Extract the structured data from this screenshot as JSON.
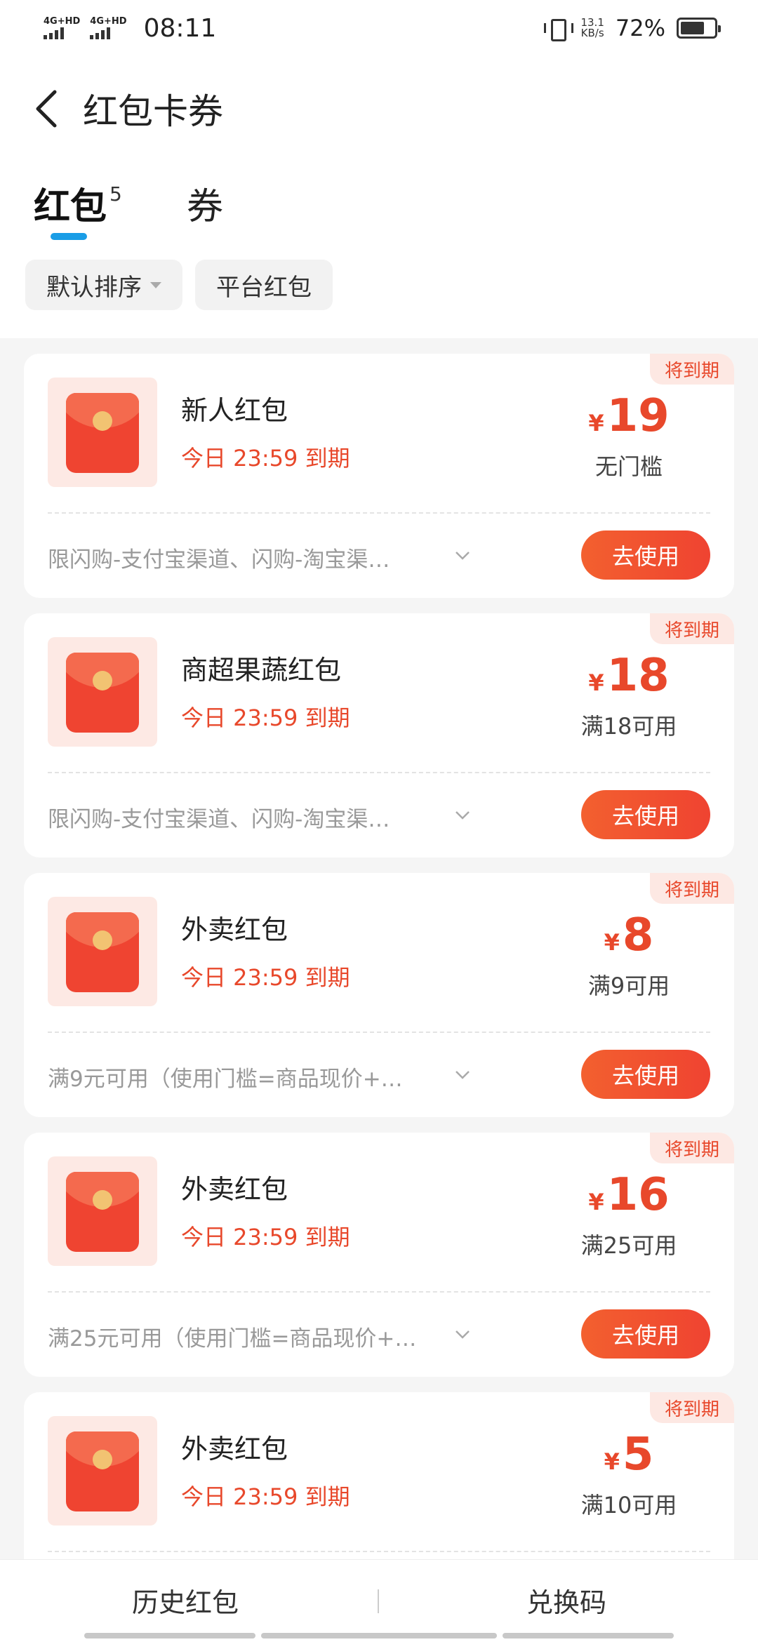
{
  "status_bar": {
    "network1": "4G+HD",
    "network2": "4G+HD",
    "time": "08:11",
    "speed_value": "13.1",
    "speed_unit": "KB/s",
    "battery": "72%",
    "battery_level": 0.72
  },
  "header": {
    "title": "红包卡券"
  },
  "tabs": {
    "hongbao_label": "红包",
    "hongbao_count": "5",
    "quan_label": "券",
    "active": "红包",
    "accent_color": "#1a9de6"
  },
  "filters": {
    "sort_label": "默认排序",
    "platform_label": "平台红包"
  },
  "cards": [
    {
      "badge": "将到期",
      "name": "新人红包",
      "due": "今日 23:59 到期",
      "currency": "¥",
      "amount": "19",
      "condition": "无门槛",
      "desc": "限闪购-支付宝渠道、闪购-淘宝渠…",
      "button": "去使用"
    },
    {
      "badge": "将到期",
      "name": "商超果蔬红包",
      "due": "今日 23:59 到期",
      "currency": "¥",
      "amount": "18",
      "condition": "满18可用",
      "desc": "限闪购-支付宝渠道、闪购-淘宝渠…",
      "button": "去使用"
    },
    {
      "badge": "将到期",
      "name": "外卖红包",
      "due": "今日 23:59 到期",
      "currency": "¥",
      "amount": "8",
      "condition": "满9可用",
      "desc": "满9元可用（使用门槛=商品现价+…",
      "button": "去使用"
    },
    {
      "badge": "将到期",
      "name": "外卖红包",
      "due": "今日 23:59 到期",
      "currency": "¥",
      "amount": "16",
      "condition": "满25可用",
      "desc": "满25元可用（使用门槛=商品现价+…",
      "button": "去使用"
    },
    {
      "badge": "将到期",
      "name": "外卖红包",
      "due": "今日 23:59 到期",
      "currency": "¥",
      "amount": "5",
      "condition": "满10可用",
      "desc": "",
      "button": ""
    }
  ],
  "bottom_bar": {
    "history_label": "历史红包",
    "redeem_label": "兑换码"
  },
  "colors": {
    "brand_red": "#e8482b",
    "button_gradient_start": "#f3602f",
    "button_gradient_end": "#ef4331"
  }
}
